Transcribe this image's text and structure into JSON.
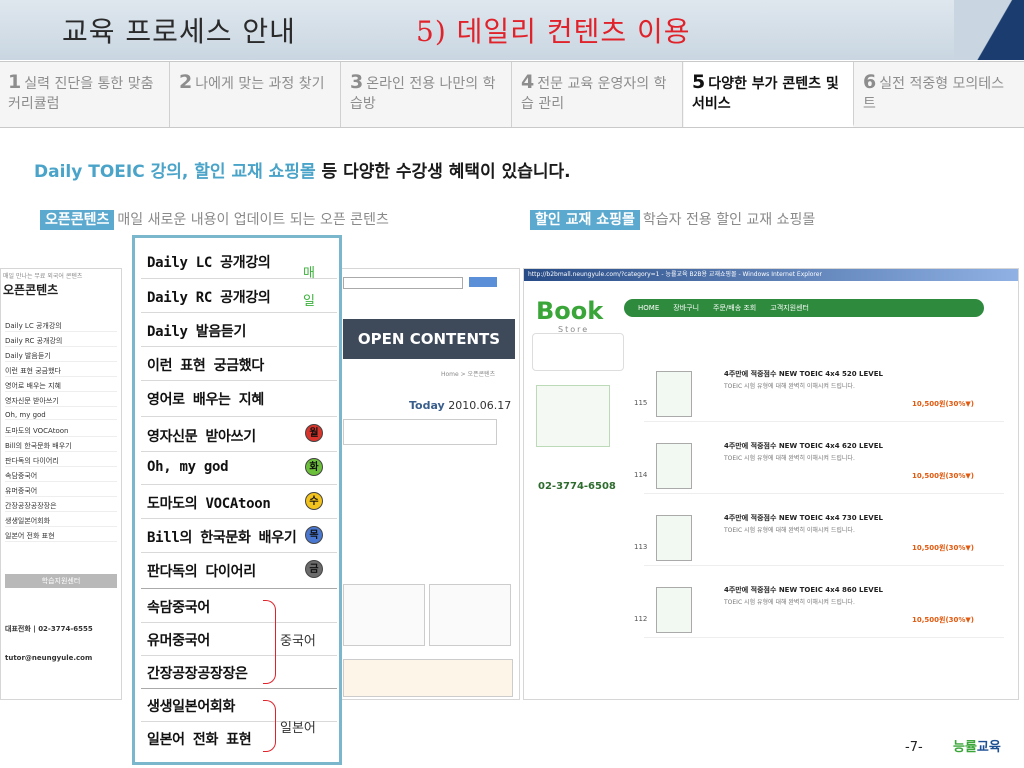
{
  "header": {
    "title": "교육 프로세스 안내",
    "section": "5) 데일리 컨텐츠 이용"
  },
  "tabs": [
    {
      "num": "1",
      "label": "실력 진단을 통한 맞춤 커리큘럼"
    },
    {
      "num": "2",
      "label": "나에게 맞는 과정 찾기"
    },
    {
      "num": "3",
      "label": "온라인 전용 나만의 학습방"
    },
    {
      "num": "4",
      "label": "전문 교육 운영자의 학습 관리"
    },
    {
      "num": "5",
      "label": "다양한 부가 콘텐츠 및 서비스"
    },
    {
      "num": "6",
      "label": "실전 적중형 모의테스트"
    }
  ],
  "headline": {
    "highlight": "Daily TOEIC 강의, 할인 교재 쇼핑몰",
    "rest": " 등 다양한 수강생 혜택이 있습니다."
  },
  "left": {
    "tag": "오픈콘텐츠",
    "desc": "매일 새로운 내용이 업데이트 되는 오픈 콘텐츠"
  },
  "right": {
    "tag": "할인 교재 쇼핑몰",
    "desc": "학습자 전용 할인 교재 쇼핑몰"
  },
  "panel": {
    "items": [
      "Daily LC 공개강의",
      "Daily RC 공개강의",
      "Daily 발음듣기",
      "이런 표현 궁금했다",
      "영어로 배우는 지혜",
      "영자신문 받아쓰기",
      "Oh, my god",
      "도마도의 VOCAtoon",
      "Bill의 한국문화 배우기",
      "판다독의 다이어리",
      "속담중국어",
      "유머중국어",
      "간장공장공장장은",
      "생생일본어회화",
      "일본어 전화 표현"
    ],
    "daily_label_1": "매",
    "daily_label_2": "일",
    "days": [
      "월",
      "화",
      "수",
      "목",
      "금"
    ],
    "day_colors": [
      "#d9342b",
      "#6cbf3a",
      "#f2c21d",
      "#4a78d0",
      "#6b6b6b"
    ],
    "chinese_label": "중국어",
    "japanese_label": "일본어"
  },
  "leftshot": {
    "small": "매일 만나는 무료 외국어 콘텐츠",
    "big": "오픈콘텐츠",
    "items": [
      "Daily LC 공개강의",
      "Daily RC 공개강의",
      "Daily 발음듣기",
      "이런 표현 궁금했다",
      "영어로 배우는 지혜",
      "영자신문 받아쓰기",
      "Oh, my god",
      "도마도의 VOCAtoon",
      "Bill의 한국문화 배우기",
      "판다독의 다이어리",
      "속담중국어",
      "유머중국어",
      "간장공장공장장은",
      "생생일본어회화",
      "일본어 전화 표현"
    ],
    "center_title": "학습지원센터",
    "phone": "대표전화 | 02-3774-6555",
    "email": "tutor@neungyule.com",
    "oc_banner": "OPEN CONTENTS",
    "home_path": "Home > 오픈콘텐츠",
    "today_label": "Today",
    "today_date": "2010.06.17"
  },
  "rightshot": {
    "window_title": "http://b2bmall.neungyule.com/?category=1 - 능률교육 B2B용 교재쇼핑몰 - Windows Internet Explorer",
    "book": "Book",
    "store": "Store",
    "nav": [
      "HOME",
      "장바구니",
      "주문/배송 조회",
      "고객지원센터"
    ],
    "phone": "02-3774-6508",
    "products": [
      {
        "num": "115",
        "title": "4주만에 적중점수 NEW TOEIC 4x4 520 LEVEL",
        "price": "10,500원(30%▼)"
      },
      {
        "num": "114",
        "title": "4주만에 적중점수 NEW TOEIC 4x4 620 LEVEL",
        "price": "10,500원(30%▼)"
      },
      {
        "num": "113",
        "title": "4주만에 적중점수 NEW TOEIC 4x4 730 LEVEL",
        "price": "10,500원(30%▼)"
      },
      {
        "num": "112",
        "title": "4주만에 적중점수 NEW TOEIC 4x4 860 LEVEL",
        "price": "10,500원(30%▼)"
      }
    ],
    "product_desc": "TOEIC 시험 유형에 대해 완벽히 이해시켜 드립니다."
  },
  "footer": {
    "page": "-7-",
    "logo_main": "능률",
    "logo_sub": "교육"
  }
}
